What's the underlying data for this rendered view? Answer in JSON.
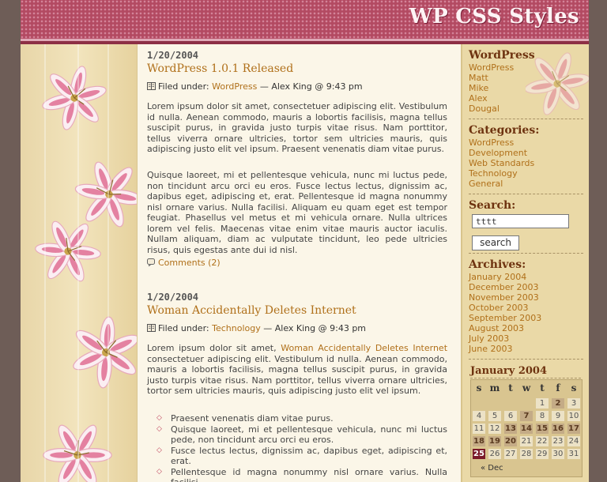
{
  "site": {
    "title": "WP CSS Styles"
  },
  "posts": [
    {
      "date": "1/20/2004",
      "title": "WordPress 1.0.1 Released",
      "filed_prefix": "Filed under:",
      "category": "WordPress",
      "author_time": "— Alex King @ 9:43 pm",
      "paragraphs": [
        "Lorem ipsum dolor sit amet, consectetuer adipiscing elit. Vestibulum id nulla. Aenean commodo, mauris a lobortis facilisis, magna tellus suscipit purus, in gravida justo turpis vitae risus. Nam porttitor, tellus viverra ornare ultricies, tortor sem ultricies mauris, quis adipiscing justo elit vel ipsum. Praesent venenatis diam vitae purus.",
        "Quisque laoreet, mi et pellentesque vehicula, nunc mi luctus pede, non tincidunt arcu orci eu eros. Fusce lectus lectus, dignissim ac, dapibus eget, adipiscing et, erat. Pellentesque id magna nonummy nisl ornare varius. Nulla facilisi. Aliquam eu quam eget est tempor feugiat. Phasellus vel metus et mi vehicula ornare. Nulla ultrices lorem vel felis. Maecenas vitae enim vitae mauris auctor iaculis. Nullam aliquam, diam ac vulputate tincidunt, leo pede ultricies risus, quis egestas ante dui id nisl."
      ],
      "comments": "Comments (2)"
    },
    {
      "date": "1/20/2004",
      "title": "Woman Accidentally Deletes Internet",
      "filed_prefix": "Filed under:",
      "category": "Technology",
      "author_time": "— Alex King @ 9:43 pm",
      "intro_start": "Lorem ipsum dolor sit amet,",
      "intro_link": "Woman Accidentally Deletes Internet",
      "intro_rest": "consectetuer adipiscing elit. Vestibulum id nulla. Aenean commodo, mauris a lobortis facilisis, magna tellus suscipit purus, in gravida justo turpis vitae risus. Nam porttitor, tellus viverra ornare ultricies, tortor sem ultricies mauris, quis adipiscing justo elit vel ipsum.",
      "bullets": [
        "Praesent venenatis diam vitae purus.",
        "Quisque laoreet, mi et pellentesque vehicula, nunc mi luctus pede, non tincidunt arcu orci eu eros.",
        "Fusce lectus lectus, dignissim ac, dapibus eget, adipiscing et, erat.",
        "Pellentesque id magna nonummy nisl ornare varius. Nulla facilisi."
      ]
    }
  ],
  "sidebar": {
    "wordpress": {
      "heading": "WordPress",
      "links": [
        "WordPress",
        "Matt",
        "Mike",
        "Alex",
        "Dougal"
      ]
    },
    "categories": {
      "heading": "Categories:",
      "links": [
        "WordPress",
        "Development",
        "Web Standards",
        "Technology",
        "General"
      ]
    },
    "search": {
      "heading": "Search:",
      "value": "tttt",
      "button": "search"
    },
    "archives": {
      "heading": "Archives:",
      "links": [
        "January 2004",
        "December 2003",
        "November 2003",
        "October 2003",
        "September 2003",
        "August 2003",
        "July 2003",
        "June 2003"
      ]
    },
    "calendar": {
      "caption": "January 2004",
      "weekdays": [
        "s",
        "m",
        "t",
        "w",
        "t",
        "f",
        "s"
      ],
      "days": [
        "1",
        "2",
        "3",
        "4",
        "5",
        "6",
        "7",
        "8",
        "9",
        "10",
        "11",
        "12",
        "13",
        "14",
        "15",
        "16",
        "17",
        "18",
        "19",
        "20",
        "21",
        "22",
        "23",
        "24",
        "25",
        "26",
        "27",
        "28",
        "29",
        "30",
        "31"
      ],
      "linked_days": [
        "2",
        "7",
        "13",
        "14",
        "15",
        "16",
        "17",
        "18",
        "19",
        "20"
      ],
      "today": "25",
      "prev": "« Dec"
    }
  },
  "colors": {
    "link": "#b0701a",
    "heading": "#6e3310",
    "header": "#b34a62",
    "today": "#7a1a2a"
  },
  "icons": {
    "post_meta": "document-icon",
    "comments": "comment-icon",
    "decor": "lily-flower"
  }
}
